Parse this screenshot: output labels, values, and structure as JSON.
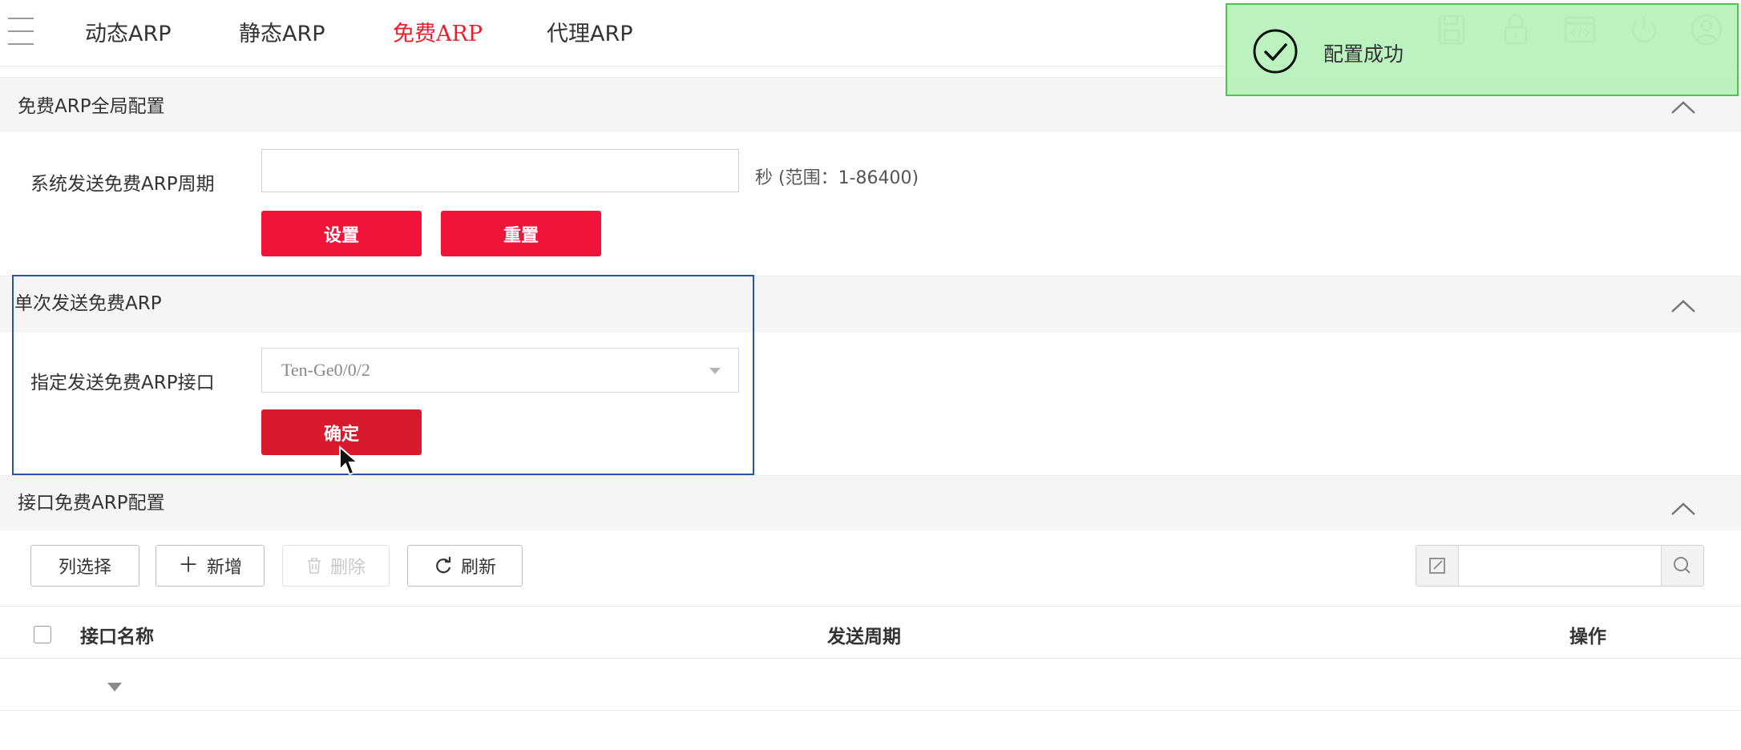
{
  "nav": {
    "tabs": [
      {
        "label": "动态ARP"
      },
      {
        "label": "静态ARP"
      },
      {
        "label": "免费ARP",
        "active": true
      },
      {
        "label": "代理ARP"
      }
    ],
    "icons": [
      "save-icon",
      "lock-icon",
      "code-window-icon",
      "power-icon",
      "user-icon"
    ]
  },
  "global_section": {
    "title": "免费ARP全局配置",
    "field_label": "系统发送免费ARP周期",
    "field_value": "",
    "hint": "秒 (范围：1-86400)",
    "set_label": "设置",
    "reset_label": "重置"
  },
  "single_section": {
    "title": "单次发送免费ARP",
    "field_label": "指定发送免费ARP接口",
    "selected_interface": "Ten-Ge0/0/2",
    "confirm_label": "确定"
  },
  "interface_section": {
    "title": "接口免费ARP配置",
    "toolbar": {
      "column_select": "列选择",
      "add": "新增",
      "delete": "删除",
      "refresh": "刷新",
      "search_value": ""
    },
    "table": {
      "headers": [
        "接口名称",
        "发送周期",
        "操作"
      ]
    }
  },
  "toast": {
    "message": "配置成功",
    "color": "#4cc44e"
  },
  "theme": {
    "accent": "#f0143a",
    "active_tab": "#e8202e"
  }
}
